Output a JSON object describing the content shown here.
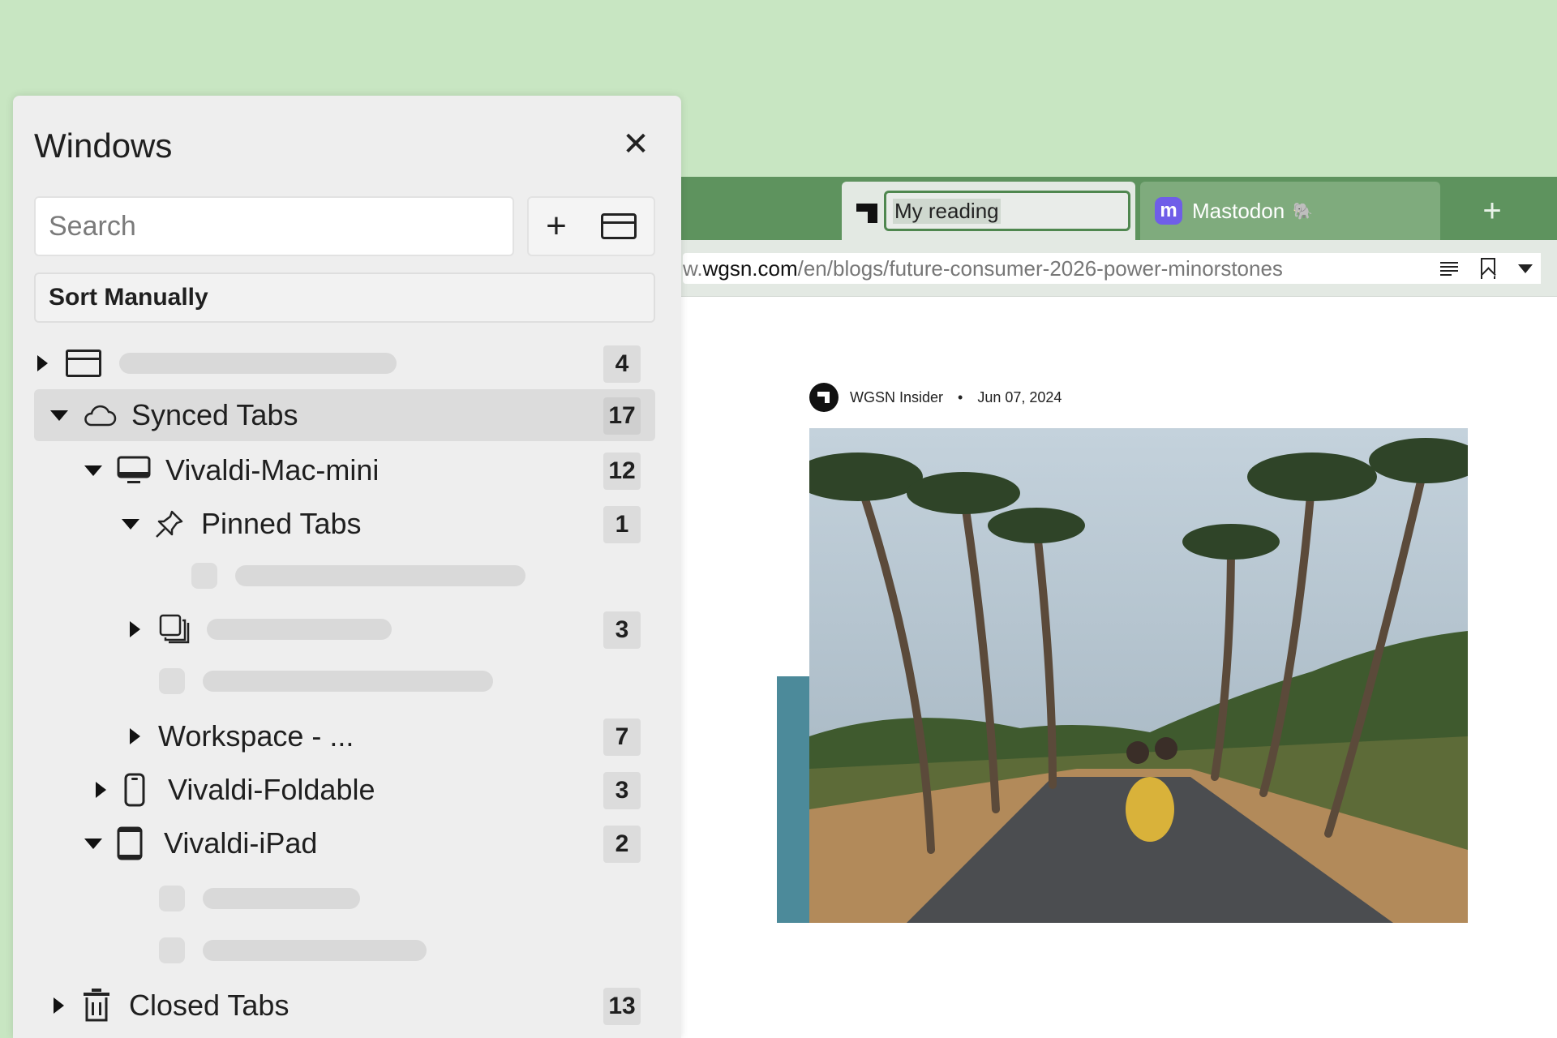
{
  "browser": {
    "tabs": [
      {
        "title": "My reading",
        "favicon": "wgsn-logo-icon",
        "active": true,
        "editing": true
      },
      {
        "title": "Mastodon",
        "favicon": "mastodon-icon",
        "emoji": "🐘",
        "active": false
      }
    ],
    "new_tab_label": "+",
    "url": {
      "prefix": "w.",
      "host": "wgsn.com",
      "path": "/en/blogs/future-consumer-2026-power-minorstones"
    },
    "page": {
      "author": "WGSN Insider",
      "separator": "•",
      "date": "Jun 07, 2024"
    }
  },
  "panel": {
    "title": "Windows",
    "close_label": "✕",
    "search_placeholder": "Search",
    "sort_label": "Sort Manually",
    "tree": [
      {
        "id": "window-1",
        "label": "",
        "count": "4",
        "expanded": false,
        "icon": "window-icon"
      },
      {
        "id": "synced-tabs",
        "label": "Synced Tabs",
        "count": "17",
        "expanded": true,
        "icon": "cloud-icon",
        "selected": true
      },
      {
        "id": "vivaldi-mac-mini",
        "label": "Vivaldi-Mac-mini",
        "count": "12",
        "expanded": true,
        "icon": "monitor-icon"
      },
      {
        "id": "pinned-tabs",
        "label": "Pinned Tabs",
        "count": "1",
        "expanded": true,
        "icon": "pin-icon"
      },
      {
        "id": "tab-stack",
        "label": "",
        "count": "3",
        "expanded": false,
        "icon": "tab-stack-icon"
      },
      {
        "id": "workspace",
        "label": "Workspace - ...",
        "count": "7",
        "expanded": false
      },
      {
        "id": "vivaldi-foldable",
        "label": "Vivaldi-Foldable",
        "count": "3",
        "expanded": false,
        "icon": "phone-icon"
      },
      {
        "id": "vivaldi-ipad",
        "label": "Vivaldi-iPad",
        "count": "2",
        "expanded": true,
        "icon": "tablet-icon"
      },
      {
        "id": "closed-tabs",
        "label": "Closed Tabs",
        "count": "13",
        "expanded": false,
        "icon": "trash-icon"
      }
    ]
  },
  "colors": {
    "background": "#c8e6c2",
    "tabbar": "#5e935e",
    "panel": "#eeeeee",
    "accent": "#4f874f"
  }
}
